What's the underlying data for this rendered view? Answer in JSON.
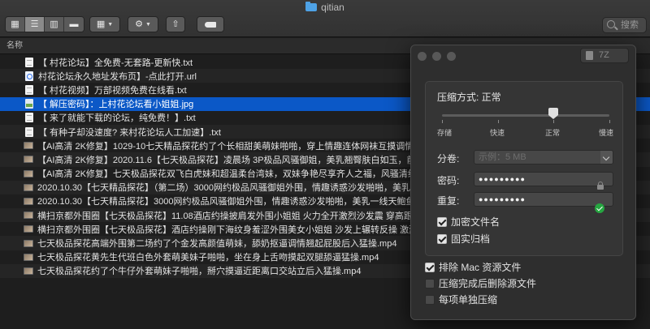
{
  "window": {
    "title": "qitian"
  },
  "toolbar": {
    "search_placeholder": "搜索",
    "icons": [
      "view-icon-grid",
      "view-icon-list",
      "view-icon-columns",
      "view-icon-gallery",
      "group-icon",
      "action-gear-icon",
      "share-icon",
      "tag-icon"
    ]
  },
  "columns": {
    "name": "名称"
  },
  "files": [
    {
      "name": "【 村花论坛】全免费-无套路-更新快.txt",
      "kind": "doc"
    },
    {
      "name": "村花论坛永久地址发布页】-点此打开.url",
      "kind": "url"
    },
    {
      "name": "【 村花视频】万部视频免费在线看.txt",
      "kind": "doc"
    },
    {
      "name": "【 解压密码】：上村花论坛看小姐姐.jpg",
      "kind": "img",
      "selected": true
    },
    {
      "name": "【 来了就能下载的论坛，纯免费！】.txt",
      "kind": "doc"
    },
    {
      "name": "【 有种子却没速度? 来村花论坛人工加速】.txt",
      "kind": "doc"
    },
    {
      "name": "【AI高清 2K修复】1029-10七天精品探花约了个长相甜美萌妹啪啪，穿上情趣连体网袜互摸调情",
      "kind": "vid"
    },
    {
      "name": "【AI高清 2K修复】2020.11.6【七天极品探花】凌晨场 3P极品风骚御姐，美乳翘臀肤白如玉，前凸",
      "kind": "vid"
    },
    {
      "name": "【AI高清 2K修复】七天极品探花双飞白虎妹和超温柔台湾妹，双妹争艳尽享齐人之福，风骚清纯并",
      "kind": "vid"
    },
    {
      "name": "2020.10.30【七天精品探花】（第二场）3000网约极品风骚御姐外围，情趣诱惑沙发啪啪，美乳翘",
      "kind": "vid"
    },
    {
      "name": "2020.10.30【七天精品探花】3000网约极品风骚御姐外围，情趣诱惑沙发啪啪，美乳一线天鲍鱼",
      "kind": "vid"
    },
    {
      "name": "横扫京都外围圈【七天极品探花】11.08酒店约操披肩发外围小姐姐 火力全开激烈沙发震 穿高跟鞋",
      "kind": "vid"
    },
    {
      "name": "横扫京都外围圈【七天极品探花】酒店约操刚下海纹身羞涩外围美女小姐姐 沙发上辗转反操 激烈",
      "kind": "vid"
    },
    {
      "name": "七天极品探花高端外围第二场约了个金发高颜值萌妹，舔奶抠逼调情翘起屁股后入猛操.mp4",
      "kind": "vid"
    },
    {
      "name": "七天极品探花黄先生代班白色外套萌美妹子啪啪，坐在身上舌吻摸起双腿舔逼猛操.mp4",
      "kind": "vid"
    },
    {
      "name": "七天极品探花约了个牛仔外套萌妹子啪啪，掰穴摸逼近距离口交站立后入猛操.mp4",
      "kind": "vid"
    }
  ],
  "dialog": {
    "format": "7Z",
    "level_title": "压缩方式: 正常",
    "levels": [
      "存储",
      "快速",
      "正常",
      "慢速"
    ],
    "slider_value": 0.667,
    "split_label": "分卷:",
    "split_placeholder": "示例：5 MB",
    "password_label": "密码:",
    "password_mask": "●●●●●●●●●",
    "repeat_label": "重复:",
    "repeat_mask": "●●●●●●●●●",
    "options_inner": [
      {
        "label": "加密文件名",
        "checked": true
      },
      {
        "label": "固实归档",
        "checked": true
      }
    ],
    "options_outer": [
      {
        "label": "排除 Mac 资源文件",
        "checked": true
      },
      {
        "label": "压缩完成后删除源文件",
        "checked": false
      },
      {
        "label": "每项单独压缩",
        "checked": false
      }
    ],
    "colors": {
      "selection": "#0b58c7",
      "success": "#26a641"
    }
  }
}
